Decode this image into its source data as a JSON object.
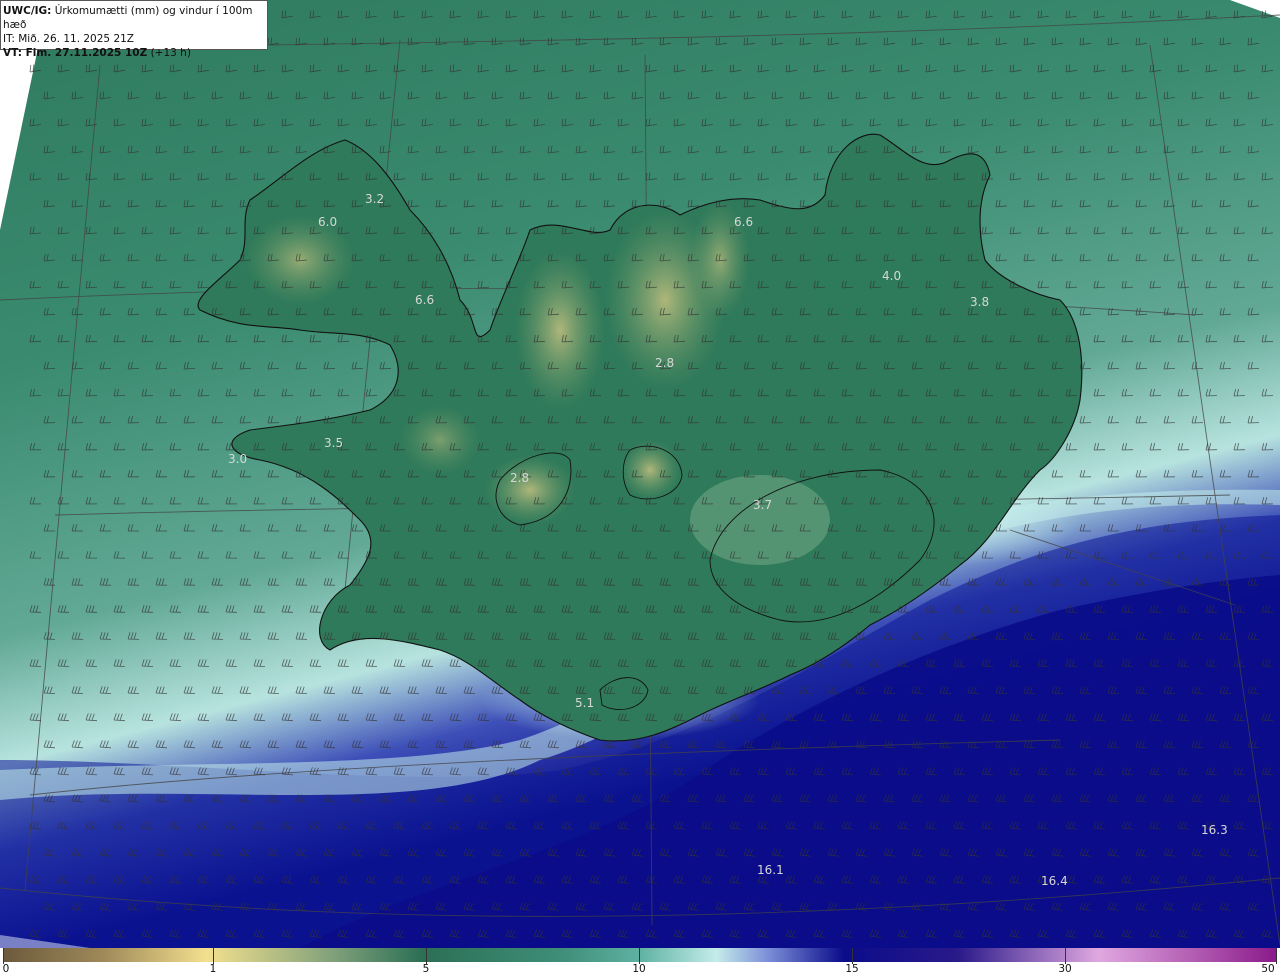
{
  "header": {
    "line1_bold": "UWC/IG:",
    "line1_text": " Úrkomumætti (mm) og vindur í 100m hæð",
    "line2_text": "IT: Mið. 26. 11. 2025 21Z",
    "line3_bold": "VT: Fim. 27.11.2025 10Z",
    "line3_text": " (+13 h)"
  },
  "map": {
    "colors": {
      "land_dark": "#2a6b4f",
      "sea_teal": "#3f8f79",
      "highland": "#a7b579",
      "ice_light": "#bfe9e6",
      "deep_blue": "#0a0c8a",
      "coast": "#111111",
      "barb": "#333333"
    },
    "value_labels": [
      {
        "text": "3.2",
        "area": "westfjords-north"
      },
      {
        "text": "6.0",
        "area": "westfjords-west"
      },
      {
        "text": "6.6",
        "area": "westfjords-east"
      },
      {
        "text": "6.6",
        "area": "north-coast"
      },
      {
        "text": "4.0",
        "area": "northeast"
      },
      {
        "text": "3.8",
        "area": "east"
      },
      {
        "text": "2.8",
        "area": "north-highland"
      },
      {
        "text": "3.5",
        "area": "snaefellsnes"
      },
      {
        "text": "3.0",
        "area": "snaefellsnes-tip"
      },
      {
        "text": "2.8",
        "area": "langjokull"
      },
      {
        "text": "3.7",
        "area": "vatnajokull"
      },
      {
        "text": "5.1",
        "area": "south"
      },
      {
        "text": "16.1",
        "area": "sea-south"
      },
      {
        "text": "16.4",
        "area": "sea-southeast"
      },
      {
        "text": "16.3",
        "area": "sea-east"
      }
    ]
  },
  "colorbar": {
    "ticks": [
      "0",
      "1",
      "5",
      "10",
      "15",
      "30",
      "50"
    ]
  }
}
